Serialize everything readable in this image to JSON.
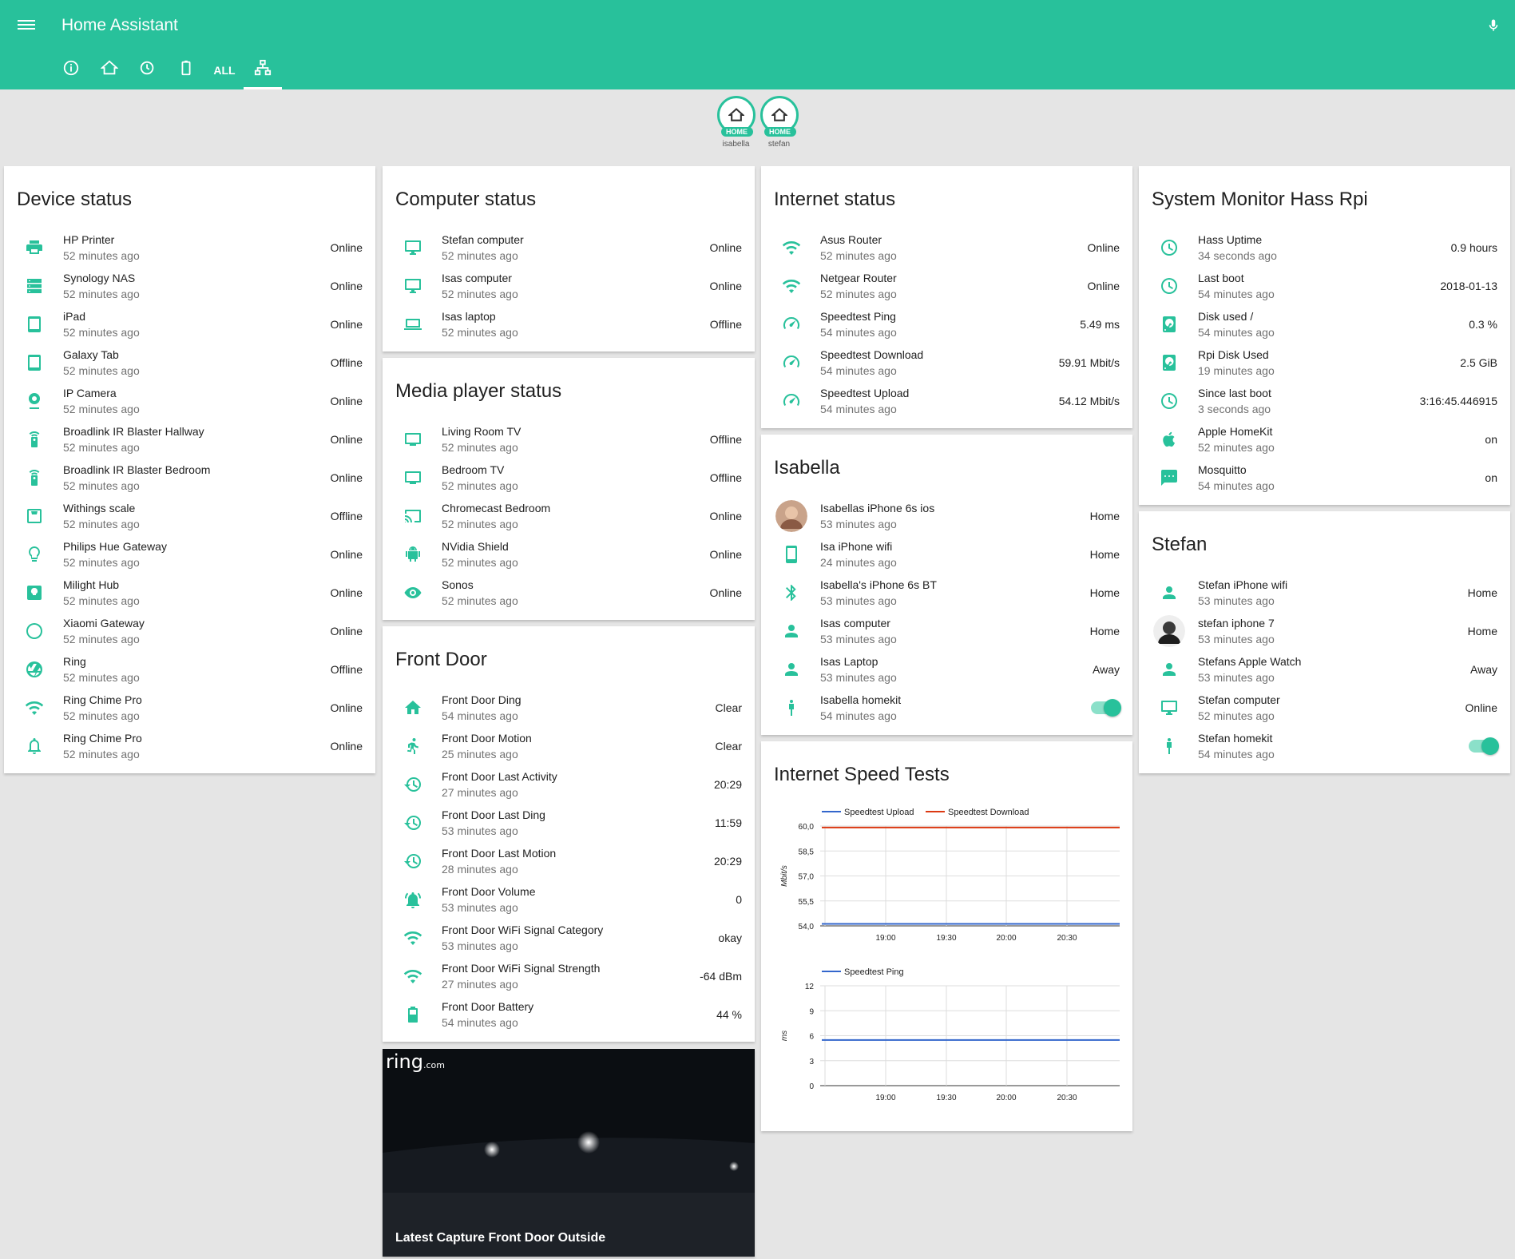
{
  "header": {
    "title": "Home Assistant",
    "tabs": [
      {
        "label": "info"
      },
      {
        "label": "home"
      },
      {
        "label": "history"
      },
      {
        "label": "battery"
      },
      {
        "label": "ALL"
      },
      {
        "label": "network"
      }
    ]
  },
  "badges": [
    {
      "label": "HOME",
      "name": "isabella"
    },
    {
      "label": "HOME",
      "name": "stefan"
    }
  ],
  "device_status": {
    "title": "Device status",
    "rows": [
      {
        "name": "HP Printer",
        "ago": "52 minutes ago",
        "state": "Online",
        "icon": "printer-icon"
      },
      {
        "name": "Synology NAS",
        "ago": "52 minutes ago",
        "state": "Online",
        "icon": "server-icon"
      },
      {
        "name": "iPad",
        "ago": "52 minutes ago",
        "state": "Online",
        "icon": "tablet-icon"
      },
      {
        "name": "Galaxy Tab",
        "ago": "52 minutes ago",
        "state": "Offline",
        "icon": "tablet-icon"
      },
      {
        "name": "IP Camera",
        "ago": "52 minutes ago",
        "state": "Online",
        "icon": "webcam-icon"
      },
      {
        "name": "Broadlink IR Blaster Hallway",
        "ago": "52 minutes ago",
        "state": "Online",
        "icon": "remote-icon"
      },
      {
        "name": "Broadlink IR Blaster Bedroom",
        "ago": "52 minutes ago",
        "state": "Online",
        "icon": "remote-icon"
      },
      {
        "name": "Withings scale",
        "ago": "52 minutes ago",
        "state": "Offline",
        "icon": "scale-icon"
      },
      {
        "name": "Philips Hue Gateway",
        "ago": "52 minutes ago",
        "state": "Online",
        "icon": "lightbulb-icon"
      },
      {
        "name": "Milight Hub",
        "ago": "52 minutes ago",
        "state": "Online",
        "icon": "lightbulb-box-icon"
      },
      {
        "name": "Xiaomi Gateway",
        "ago": "52 minutes ago",
        "state": "Online",
        "icon": "circle-icon"
      },
      {
        "name": "Ring",
        "ago": "52 minutes ago",
        "state": "Offline",
        "icon": "camera-iris-icon"
      },
      {
        "name": "Ring Chime Pro",
        "ago": "52 minutes ago",
        "state": "Online",
        "icon": "wifi-icon"
      },
      {
        "name": "Ring Chime Pro",
        "ago": "52 minutes ago",
        "state": "Online",
        "icon": "bell-icon"
      }
    ]
  },
  "computer_status": {
    "title": "Computer status",
    "rows": [
      {
        "name": "Stefan computer",
        "ago": "52 minutes ago",
        "state": "Online",
        "icon": "monitor-icon"
      },
      {
        "name": "Isas computer",
        "ago": "52 minutes ago",
        "state": "Online",
        "icon": "monitor-icon"
      },
      {
        "name": "Isas laptop",
        "ago": "52 minutes ago",
        "state": "Offline",
        "icon": "laptop-icon"
      }
    ]
  },
  "media_status": {
    "title": "Media player status",
    "rows": [
      {
        "name": "Living Room TV",
        "ago": "52 minutes ago",
        "state": "Offline",
        "icon": "tv-icon"
      },
      {
        "name": "Bedroom TV",
        "ago": "52 minutes ago",
        "state": "Offline",
        "icon": "tv-icon"
      },
      {
        "name": "Chromecast Bedroom",
        "ago": "52 minutes ago",
        "state": "Online",
        "icon": "cast-icon"
      },
      {
        "name": "NVidia Shield",
        "ago": "52 minutes ago",
        "state": "Online",
        "icon": "android-icon"
      },
      {
        "name": "Sonos",
        "ago": "52 minutes ago",
        "state": "Online",
        "icon": "eye-icon"
      }
    ]
  },
  "front_door": {
    "title": "Front Door",
    "rows": [
      {
        "name": "Front Door Ding",
        "ago": "54 minutes ago",
        "state": "Clear",
        "icon": "home-icon"
      },
      {
        "name": "Front Door Motion",
        "ago": "25 minutes ago",
        "state": "Clear",
        "icon": "walk-icon"
      },
      {
        "name": "Front Door Last Activity",
        "ago": "27 minutes ago",
        "state": "20:29",
        "icon": "history-icon"
      },
      {
        "name": "Front Door Last Ding",
        "ago": "53 minutes ago",
        "state": "11:59",
        "icon": "history-icon"
      },
      {
        "name": "Front Door Last Motion",
        "ago": "28 minutes ago",
        "state": "20:29",
        "icon": "history-icon"
      },
      {
        "name": "Front Door Volume",
        "ago": "53 minutes ago",
        "state": "0",
        "icon": "bell-ring-icon"
      },
      {
        "name": "Front Door WiFi Signal Category",
        "ago": "53 minutes ago",
        "state": "okay",
        "icon": "wifi-icon"
      },
      {
        "name": "Front Door WiFi Signal Strength",
        "ago": "27 minutes ago",
        "state": "-64 dBm",
        "icon": "wifi-icon"
      },
      {
        "name": "Front Door Battery",
        "ago": "54 minutes ago",
        "state": "44 %",
        "icon": "battery-icon"
      }
    ]
  },
  "camera": {
    "caption": "Latest Capture Front Door Outside",
    "brand": "ring",
    "brand_suffix": ".com"
  },
  "internet_status": {
    "title": "Internet status",
    "rows": [
      {
        "name": "Asus Router",
        "ago": "52 minutes ago",
        "state": "Online",
        "icon": "wifi-icon"
      },
      {
        "name": "Netgear Router",
        "ago": "52 minutes ago",
        "state": "Online",
        "icon": "wifi-icon"
      },
      {
        "name": "Speedtest Ping",
        "ago": "54 minutes ago",
        "state": "5.49 ms",
        "icon": "speedometer-icon"
      },
      {
        "name": "Speedtest Download",
        "ago": "54 minutes ago",
        "state": "59.91 Mbit/s",
        "icon": "speedometer-icon"
      },
      {
        "name": "Speedtest Upload",
        "ago": "54 minutes ago",
        "state": "54.12 Mbit/s",
        "icon": "speedometer-icon"
      }
    ]
  },
  "isabella": {
    "title": "Isabella",
    "rows": [
      {
        "name": "Isabellas iPhone 6s ios",
        "ago": "53 minutes ago",
        "state": "Home",
        "icon": "avatar-isabella"
      },
      {
        "name": "Isa iPhone wifi",
        "ago": "24 minutes ago",
        "state": "Home",
        "icon": "cellphone-icon"
      },
      {
        "name": "Isabella's iPhone 6s BT",
        "ago": "53 minutes ago",
        "state": "Home",
        "icon": "bluetooth-icon"
      },
      {
        "name": "Isas computer",
        "ago": "53 minutes ago",
        "state": "Home",
        "icon": "account-icon"
      },
      {
        "name": "Isas Laptop",
        "ago": "53 minutes ago",
        "state": "Away",
        "icon": "account-icon"
      },
      {
        "name": "Isabella homekit",
        "ago": "54 minutes ago",
        "state": "",
        "icon": "human-icon",
        "toggle": true
      }
    ]
  },
  "speed_tests": {
    "title": "Internet Speed Tests"
  },
  "system_monitor": {
    "title": "System Monitor Hass Rpi",
    "rows": [
      {
        "name": "Hass Uptime",
        "ago": "34 seconds ago",
        "state": "0.9 hours",
        "icon": "clock-icon"
      },
      {
        "name": "Last boot",
        "ago": "54 minutes ago",
        "state": "2018-01-13",
        "icon": "clock-icon"
      },
      {
        "name": "Disk used /",
        "ago": "54 minutes ago",
        "state": "0.3 %",
        "icon": "harddisk-icon"
      },
      {
        "name": "Rpi Disk Used",
        "ago": "19 minutes ago",
        "state": "2.5 GiB",
        "icon": "harddisk-icon"
      },
      {
        "name": "Since last boot",
        "ago": "3 seconds ago",
        "state": "3:16:45.446915",
        "icon": "clock-icon"
      },
      {
        "name": "Apple HomeKit",
        "ago": "52 minutes ago",
        "state": "on",
        "icon": "apple-icon"
      },
      {
        "name": "Mosquitto",
        "ago": "54 minutes ago",
        "state": "on",
        "icon": "message-icon"
      }
    ]
  },
  "stefan": {
    "title": "Stefan",
    "rows": [
      {
        "name": "Stefan iPhone wifi",
        "ago": "53 minutes ago",
        "state": "Home",
        "icon": "account-icon"
      },
      {
        "name": "stefan iphone 7",
        "ago": "53 minutes ago",
        "state": "Home",
        "icon": "avatar-stefan"
      },
      {
        "name": "Stefans Apple Watch",
        "ago": "53 minutes ago",
        "state": "Away",
        "icon": "account-icon"
      },
      {
        "name": "Stefan computer",
        "ago": "52 minutes ago",
        "state": "Online",
        "icon": "monitor-icon"
      },
      {
        "name": "Stefan homekit",
        "ago": "54 minutes ago",
        "state": "",
        "icon": "human-icon",
        "toggle": true
      }
    ]
  },
  "colors": {
    "accent": "#28c19b",
    "upload": "#3366cc",
    "download": "#dc3912"
  },
  "chart_data": [
    {
      "type": "line",
      "title": "",
      "ylabel": "Mbit/s",
      "ylim": [
        54,
        60
      ],
      "yticks": [
        "60,0",
        "58,5",
        "57,0",
        "55,5",
        "54,0"
      ],
      "xticks": [
        "19:00",
        "19:30",
        "20:00",
        "20:30"
      ],
      "series": [
        {
          "name": "Speedtest Upload",
          "values": [
            54.12,
            54.12
          ]
        },
        {
          "name": "Speedtest Download",
          "values": [
            59.91,
            59.91
          ]
        }
      ]
    },
    {
      "type": "line",
      "title": "",
      "ylabel": "ms",
      "ylim": [
        0,
        12
      ],
      "yticks": [
        "12",
        "9",
        "6",
        "3",
        "0"
      ],
      "xticks": [
        "19:00",
        "19:30",
        "20:00",
        "20:30"
      ],
      "series": [
        {
          "name": "Speedtest Ping",
          "values": [
            5.49,
            5.49
          ]
        }
      ]
    }
  ]
}
